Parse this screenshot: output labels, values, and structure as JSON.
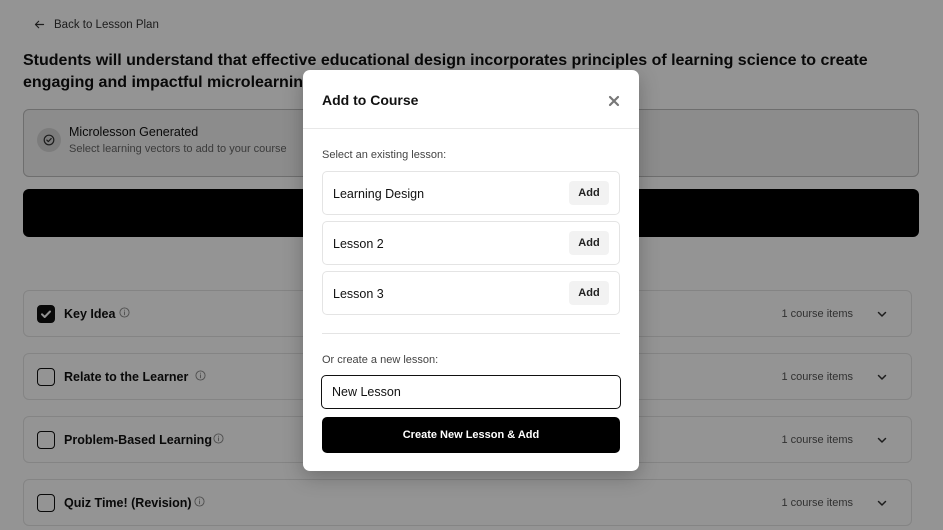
{
  "nav": {
    "back_label": "Back to Lesson Plan"
  },
  "headline": "Students will understand that effective educational design incorporates principles of learning science to create engaging and impactful microlearning experiences",
  "status": {
    "title": "Microlesson Generated",
    "subtitle": "Select learning vectors to add to your course"
  },
  "vectors": [
    {
      "label": "Key Idea",
      "checked": true,
      "count": "1 course items"
    },
    {
      "label": "Relate to the Learner",
      "checked": false,
      "count": "1 course items"
    },
    {
      "label": "Problem-Based Learning",
      "checked": false,
      "count": "1 course items"
    },
    {
      "label": "Quiz Time! (Revision)",
      "checked": false,
      "count": "1 course items"
    }
  ],
  "modal": {
    "title": "Add to Course",
    "existing_label": "Select an existing lesson:",
    "lessons": [
      {
        "name": "Learning Design",
        "add_label": "Add"
      },
      {
        "name": "Lesson 2",
        "add_label": "Add"
      },
      {
        "name": "Lesson 3",
        "add_label": "Add"
      }
    ],
    "create_label": "Or create a new lesson:",
    "new_lesson_value": "New Lesson",
    "create_button_label": "Create New Lesson & Add"
  },
  "icons": {
    "back": "arrow-left-icon",
    "status": "circle-check-icon",
    "info": "info-icon",
    "chevron": "chevron-down-icon",
    "close": "close-icon"
  },
  "colors": {
    "accent": "#000000",
    "overlay": "rgba(0,0,0,0.42)"
  }
}
